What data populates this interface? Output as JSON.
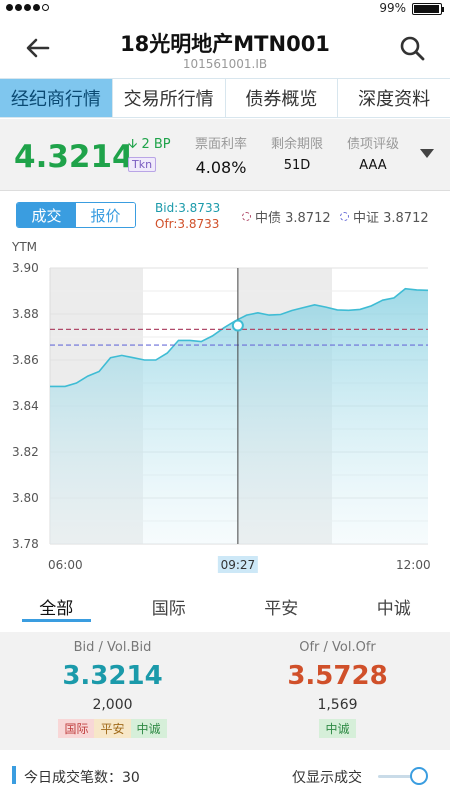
{
  "status": {
    "battery": "99%"
  },
  "header": {
    "title": "18光明地产MTN001",
    "code": "101561001.IB"
  },
  "tabs": [
    {
      "label": "经纪商行情",
      "active": true
    },
    {
      "label": "交易所行情"
    },
    {
      "label": "债券概览"
    },
    {
      "label": "深度资料"
    }
  ],
  "quote": {
    "price": "4.3214",
    "change": "2 BP",
    "tag": "Tkn",
    "coupon_label": "票面利率",
    "coupon": "4.08%",
    "term_label": "剩余期限",
    "term": "51D",
    "rating_label": "债项评级",
    "rating": "AAA"
  },
  "toolbar": {
    "seg_trade": "成交",
    "seg_quote": "报价",
    "bid": "Bid:3.8733",
    "ofr": "Ofr:3.8733",
    "ref1": "中债 3.8712",
    "ref2": "中证 3.8712"
  },
  "colors": {
    "accent": "#3a9de0",
    "green": "#1fa34a",
    "bid": "#1b9aaa",
    "ofr": "#d0502a"
  },
  "chart_data": {
    "type": "area",
    "ylabel": "YTM",
    "ylim": [
      3.78,
      3.9
    ],
    "yticks": [
      "3.90",
      "3.88",
      "3.86",
      "3.84",
      "3.82",
      "3.80",
      "3.78"
    ],
    "xticks": [
      "06:00",
      "12:00"
    ],
    "crosshair_label": "09:27",
    "crosshair_x": 0.497,
    "crosshair_y": 3.875,
    "ref_lines": [
      {
        "name": "中债",
        "value": 3.8733,
        "color": "#b04b6a"
      },
      {
        "name": "中证",
        "value": 3.8665,
        "color": "#6a6ed8"
      }
    ],
    "x": [
      0,
      0.04,
      0.07,
      0.1,
      0.13,
      0.16,
      0.19,
      0.22,
      0.25,
      0.28,
      0.31,
      0.34,
      0.37,
      0.4,
      0.43,
      0.46,
      0.49,
      0.52,
      0.55,
      0.58,
      0.61,
      0.64,
      0.67,
      0.7,
      0.73,
      0.76,
      0.79,
      0.82,
      0.85,
      0.88,
      0.91,
      0.94,
      0.97,
      1.0
    ],
    "values": [
      3.8485,
      3.8485,
      3.85,
      3.853,
      3.855,
      3.861,
      3.862,
      3.861,
      3.86,
      3.86,
      3.863,
      3.8685,
      3.8685,
      3.868,
      3.8705,
      3.874,
      3.877,
      3.8795,
      3.8805,
      3.8795,
      3.8798,
      3.8815,
      3.8828,
      3.884,
      3.883,
      3.8818,
      3.8816,
      3.882,
      3.8835,
      3.886,
      3.887,
      3.891,
      3.8905,
      3.8903
    ]
  },
  "bottom_tabs": [
    {
      "label": "全部",
      "active": true
    },
    {
      "label": "国际"
    },
    {
      "label": "平安"
    },
    {
      "label": "中诚"
    }
  ],
  "panel": {
    "bid_label": "Bid / Vol.Bid",
    "bid": "3.3214",
    "bid_vol": "2,000",
    "bid_sources": [
      "国际",
      "平安",
      "中诚"
    ],
    "ofr_label": "Ofr / Vol.Ofr",
    "ofr": "3.5728",
    "ofr_vol": "1,569",
    "ofr_sources": [
      "中诚"
    ]
  },
  "footer": {
    "count_label": "今日成交笔数：30",
    "only_label": "仅显示成交"
  }
}
